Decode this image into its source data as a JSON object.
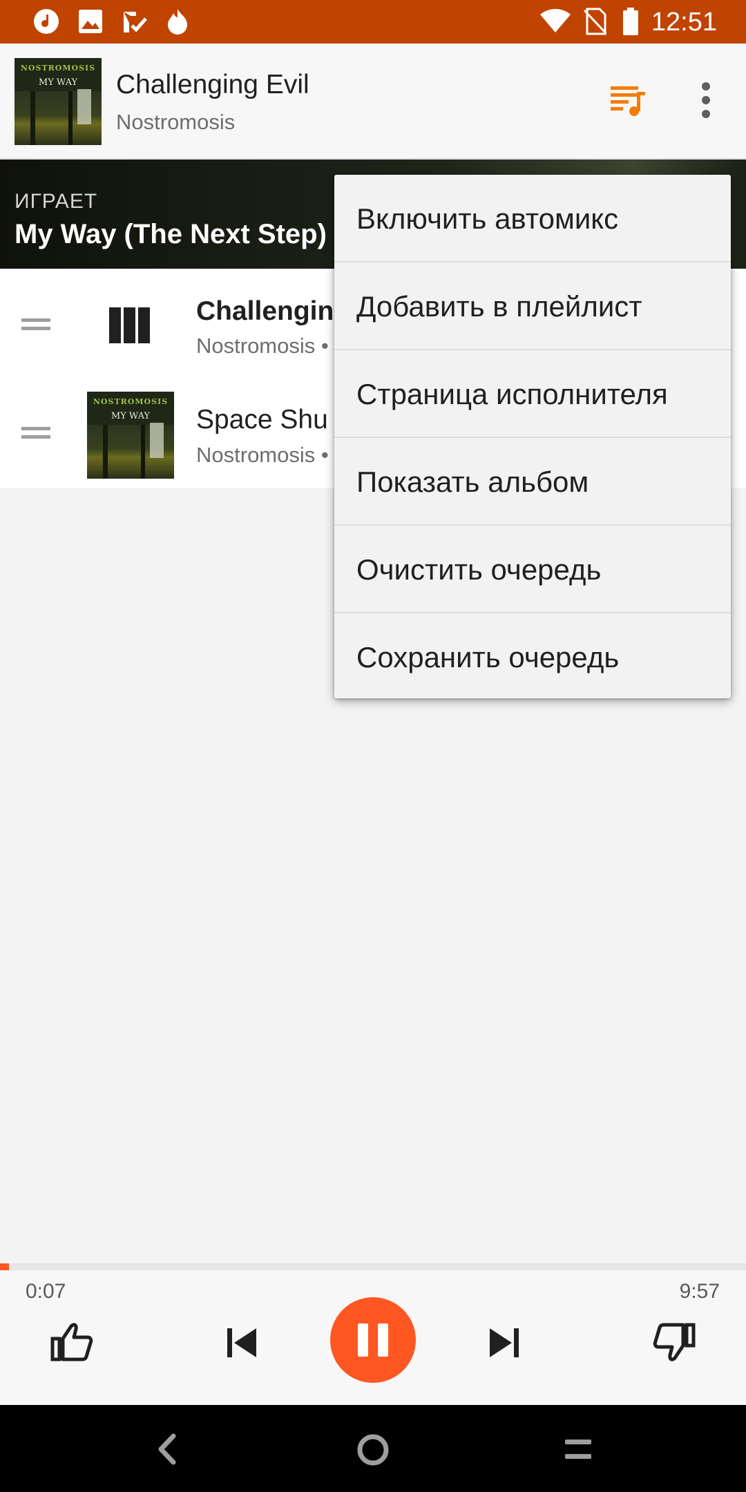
{
  "status_bar": {
    "time": "12:51",
    "left_icons": [
      "music-note-icon",
      "image-icon",
      "cast-check-icon",
      "fire-icon"
    ],
    "right_icons": [
      "wifi-icon",
      "no-sim-icon",
      "battery-icon"
    ],
    "bg_color": "#c14300"
  },
  "header": {
    "title": "Challenging Evil",
    "subtitle": "Nostromosis",
    "queue_icon_color": "#f57c00"
  },
  "album_art": {
    "band": "NOSTROMOSIS",
    "title": "MY WAY"
  },
  "now_playing": {
    "label": "ИГРАЕТ",
    "title": "My Way (The Next Step)"
  },
  "queue": [
    {
      "title": "Challengin",
      "subtitle": "Nostromosis •",
      "playing": true
    },
    {
      "title": "Space Shu",
      "subtitle": "Nostromosis •",
      "playing": false
    }
  ],
  "menu": {
    "items": [
      "Включить автомикс",
      "Добавить в плейлист",
      "Страница исполнителя",
      "Показать альбом",
      "Очистить очередь",
      "Сохранить очередь"
    ]
  },
  "player": {
    "elapsed": "0:07",
    "total": "9:57",
    "progress_fraction": 0.012,
    "accent_color": "#ff5722"
  },
  "nav_bar": {
    "icons": [
      "back-icon",
      "home-icon",
      "recents-icon"
    ]
  }
}
